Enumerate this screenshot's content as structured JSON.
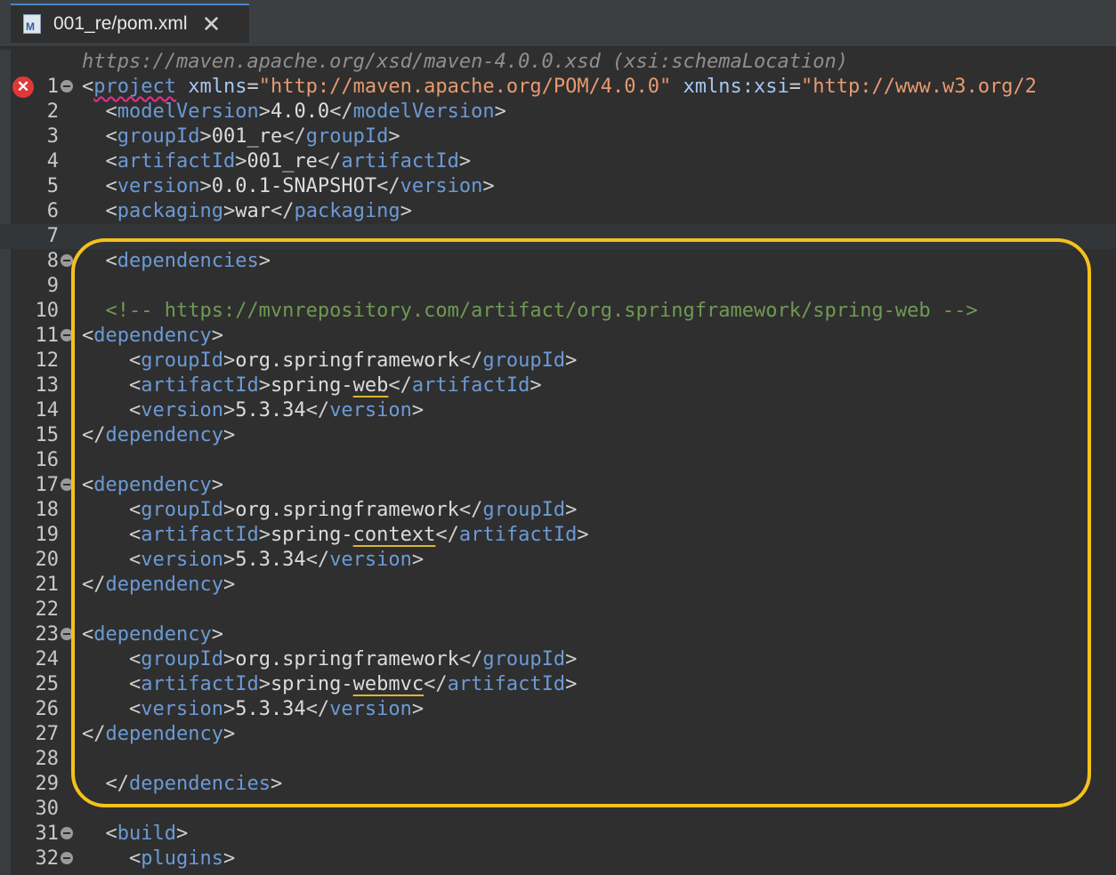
{
  "tab": {
    "label": "001_re/pom.xml",
    "icon": "maven-xml-file-icon",
    "icon_letter": "M",
    "close": "✕"
  },
  "hint": "https://maven.apache.org/xsd/maven-4.0.0.xsd (xsi:schemaLocation)",
  "colors": {
    "background": "#2f2f2f",
    "tag": "#6b9ad6",
    "punctuation": "#cfcfcf",
    "text": "#dcdcdc",
    "attribute": "#a4c8f0",
    "value": "#e89a6f",
    "comment": "#6f9a52",
    "highlight_box": "#f5c11b",
    "error": "#e0383a"
  },
  "error_line": 1,
  "lines": [
    {
      "n": "1",
      "fold": true,
      "indent": "",
      "tokens": [
        [
          "p",
          "<"
        ],
        [
          "tsq",
          "project"
        ],
        [
          "x",
          " "
        ],
        [
          "a",
          "xmlns"
        ],
        [
          "p",
          "="
        ],
        [
          "v",
          "\"http://maven.apache.org/POM/4.0.0\""
        ],
        [
          "x",
          " "
        ],
        [
          "a",
          "xmlns:xsi"
        ],
        [
          "p",
          "="
        ],
        [
          "v",
          "\"http://www.w3.org/2"
        ]
      ]
    },
    {
      "n": "2",
      "indent": "  ",
      "tokens": [
        [
          "p",
          "<"
        ],
        [
          "t",
          "modelVersion"
        ],
        [
          "p",
          ">"
        ],
        [
          "x",
          "4.0.0"
        ],
        [
          "p",
          "</"
        ],
        [
          "t",
          "modelVersion"
        ],
        [
          "p",
          ">"
        ]
      ]
    },
    {
      "n": "3",
      "indent": "  ",
      "tokens": [
        [
          "p",
          "<"
        ],
        [
          "t",
          "groupId"
        ],
        [
          "p",
          ">"
        ],
        [
          "x",
          "001_re"
        ],
        [
          "p",
          "</"
        ],
        [
          "t",
          "groupId"
        ],
        [
          "p",
          ">"
        ]
      ]
    },
    {
      "n": "4",
      "indent": "  ",
      "tokens": [
        [
          "p",
          "<"
        ],
        [
          "t",
          "artifactId"
        ],
        [
          "p",
          ">"
        ],
        [
          "x",
          "001_re"
        ],
        [
          "p",
          "</"
        ],
        [
          "t",
          "artifactId"
        ],
        [
          "p",
          ">"
        ]
      ]
    },
    {
      "n": "5",
      "indent": "  ",
      "tokens": [
        [
          "p",
          "<"
        ],
        [
          "t",
          "version"
        ],
        [
          "p",
          ">"
        ],
        [
          "x",
          "0.0.1-SNAPSHOT"
        ],
        [
          "p",
          "</"
        ],
        [
          "t",
          "version"
        ],
        [
          "p",
          ">"
        ]
      ]
    },
    {
      "n": "6",
      "indent": "  ",
      "tokens": [
        [
          "p",
          "<"
        ],
        [
          "t",
          "packaging"
        ],
        [
          "p",
          ">"
        ],
        [
          "x",
          "war"
        ],
        [
          "p",
          "</"
        ],
        [
          "t",
          "packaging"
        ],
        [
          "p",
          ">"
        ]
      ]
    },
    {
      "n": "7",
      "indent": "",
      "current": true,
      "tokens": []
    },
    {
      "n": "8",
      "fold": true,
      "indent": "  ",
      "tokens": [
        [
          "p",
          "<"
        ],
        [
          "t",
          "dependencies"
        ],
        [
          "p",
          ">"
        ]
      ]
    },
    {
      "n": "9",
      "indent": "",
      "tokens": []
    },
    {
      "n": "10",
      "indent": "  ",
      "tokens": [
        [
          "c",
          "<!-- https://mvnrepository.com/artifact/org.springframework/spring-web -->"
        ]
      ]
    },
    {
      "n": "11",
      "fold": true,
      "indent": "",
      "tokens": [
        [
          "p",
          "<"
        ],
        [
          "t",
          "dependency"
        ],
        [
          "p",
          ">"
        ]
      ]
    },
    {
      "n": "12",
      "indent": "    ",
      "tokens": [
        [
          "p",
          "<"
        ],
        [
          "t",
          "groupId"
        ],
        [
          "p",
          ">"
        ],
        [
          "x",
          "org.springframework"
        ],
        [
          "p",
          "</"
        ],
        [
          "t",
          "groupId"
        ],
        [
          "p",
          ">"
        ]
      ]
    },
    {
      "n": "13",
      "indent": "    ",
      "tokens": [
        [
          "p",
          "<"
        ],
        [
          "t",
          "artifactId"
        ],
        [
          "p",
          ">"
        ],
        [
          "x",
          "spring-"
        ],
        [
          "xul",
          "web"
        ],
        [
          "p",
          "</"
        ],
        [
          "t",
          "artifactId"
        ],
        [
          "p",
          ">"
        ]
      ]
    },
    {
      "n": "14",
      "indent": "    ",
      "tokens": [
        [
          "p",
          "<"
        ],
        [
          "t",
          "version"
        ],
        [
          "p",
          ">"
        ],
        [
          "x",
          "5.3.34"
        ],
        [
          "p",
          "</"
        ],
        [
          "t",
          "version"
        ],
        [
          "p",
          ">"
        ]
      ]
    },
    {
      "n": "15",
      "indent": "",
      "tokens": [
        [
          "p",
          "</"
        ],
        [
          "t",
          "dependency"
        ],
        [
          "p",
          ">"
        ]
      ]
    },
    {
      "n": "16",
      "indent": "",
      "tokens": []
    },
    {
      "n": "17",
      "fold": true,
      "indent": "",
      "tokens": [
        [
          "p",
          "<"
        ],
        [
          "t",
          "dependency"
        ],
        [
          "p",
          ">"
        ]
      ]
    },
    {
      "n": "18",
      "indent": "    ",
      "tokens": [
        [
          "p",
          "<"
        ],
        [
          "t",
          "groupId"
        ],
        [
          "p",
          ">"
        ],
        [
          "x",
          "org.springframework"
        ],
        [
          "p",
          "</"
        ],
        [
          "t",
          "groupId"
        ],
        [
          "p",
          ">"
        ]
      ]
    },
    {
      "n": "19",
      "indent": "    ",
      "tokens": [
        [
          "p",
          "<"
        ],
        [
          "t",
          "artifactId"
        ],
        [
          "p",
          ">"
        ],
        [
          "x",
          "spring-"
        ],
        [
          "xul",
          "context"
        ],
        [
          "p",
          "</"
        ],
        [
          "t",
          "artifactId"
        ],
        [
          "p",
          ">"
        ]
      ]
    },
    {
      "n": "20",
      "indent": "    ",
      "tokens": [
        [
          "p",
          "<"
        ],
        [
          "t",
          "version"
        ],
        [
          "p",
          ">"
        ],
        [
          "x",
          "5.3.34"
        ],
        [
          "p",
          "</"
        ],
        [
          "t",
          "version"
        ],
        [
          "p",
          ">"
        ]
      ]
    },
    {
      "n": "21",
      "indent": "",
      "tokens": [
        [
          "p",
          "</"
        ],
        [
          "t",
          "dependency"
        ],
        [
          "p",
          ">"
        ]
      ]
    },
    {
      "n": "22",
      "indent": "",
      "tokens": []
    },
    {
      "n": "23",
      "fold": true,
      "indent": "",
      "tokens": [
        [
          "p",
          "<"
        ],
        [
          "t",
          "dependency"
        ],
        [
          "p",
          ">"
        ]
      ]
    },
    {
      "n": "24",
      "indent": "    ",
      "tokens": [
        [
          "p",
          "<"
        ],
        [
          "t",
          "groupId"
        ],
        [
          "p",
          ">"
        ],
        [
          "x",
          "org.springframework"
        ],
        [
          "p",
          "</"
        ],
        [
          "t",
          "groupId"
        ],
        [
          "p",
          ">"
        ]
      ]
    },
    {
      "n": "25",
      "indent": "    ",
      "tokens": [
        [
          "p",
          "<"
        ],
        [
          "t",
          "artifactId"
        ],
        [
          "p",
          ">"
        ],
        [
          "x",
          "spring-"
        ],
        [
          "xul",
          "webmvc"
        ],
        [
          "p",
          "</"
        ],
        [
          "t",
          "artifactId"
        ],
        [
          "p",
          ">"
        ]
      ]
    },
    {
      "n": "26",
      "indent": "    ",
      "tokens": [
        [
          "p",
          "<"
        ],
        [
          "t",
          "version"
        ],
        [
          "p",
          ">"
        ],
        [
          "x",
          "5.3.34"
        ],
        [
          "p",
          "</"
        ],
        [
          "t",
          "version"
        ],
        [
          "p",
          ">"
        ]
      ]
    },
    {
      "n": "27",
      "indent": "",
      "tokens": [
        [
          "p",
          "</"
        ],
        [
          "t",
          "dependency"
        ],
        [
          "p",
          ">"
        ]
      ]
    },
    {
      "n": "28",
      "indent": "",
      "tokens": []
    },
    {
      "n": "29",
      "indent": "  ",
      "tokens": [
        [
          "p",
          "</"
        ],
        [
          "t",
          "dependencies"
        ],
        [
          "p",
          ">"
        ]
      ]
    },
    {
      "n": "30",
      "indent": "",
      "tokens": []
    },
    {
      "n": "31",
      "fold": true,
      "indent": "  ",
      "tokens": [
        [
          "p",
          "<"
        ],
        [
          "t",
          "build"
        ],
        [
          "p",
          ">"
        ]
      ]
    },
    {
      "n": "32",
      "fold": true,
      "indent": "    ",
      "tokens": [
        [
          "p",
          "<"
        ],
        [
          "t",
          "plugins"
        ],
        [
          "p",
          ">"
        ]
      ]
    }
  ]
}
